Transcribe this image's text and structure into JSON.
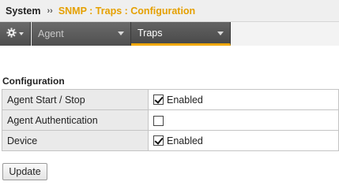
{
  "header": {
    "root": "System",
    "separator": "››",
    "breadcrumb": "SNMP : Traps : Configuration",
    "breadcrumb_color": "#e5a000"
  },
  "menu": {
    "settings_icon": "gear-icon",
    "tabs": [
      {
        "label": "Agent",
        "selected": false
      },
      {
        "label": "Traps",
        "selected": true
      }
    ],
    "active_accent": "#f0a800"
  },
  "section": {
    "title": "Configuration"
  },
  "rows": [
    {
      "label": "Agent Start / Stop",
      "checked": true,
      "value_text": "Enabled"
    },
    {
      "label": "Agent Authentication",
      "checked": false,
      "value_text": ""
    },
    {
      "label": "Device",
      "checked": true,
      "value_text": "Enabled"
    }
  ],
  "actions": {
    "update_label": "Update"
  }
}
